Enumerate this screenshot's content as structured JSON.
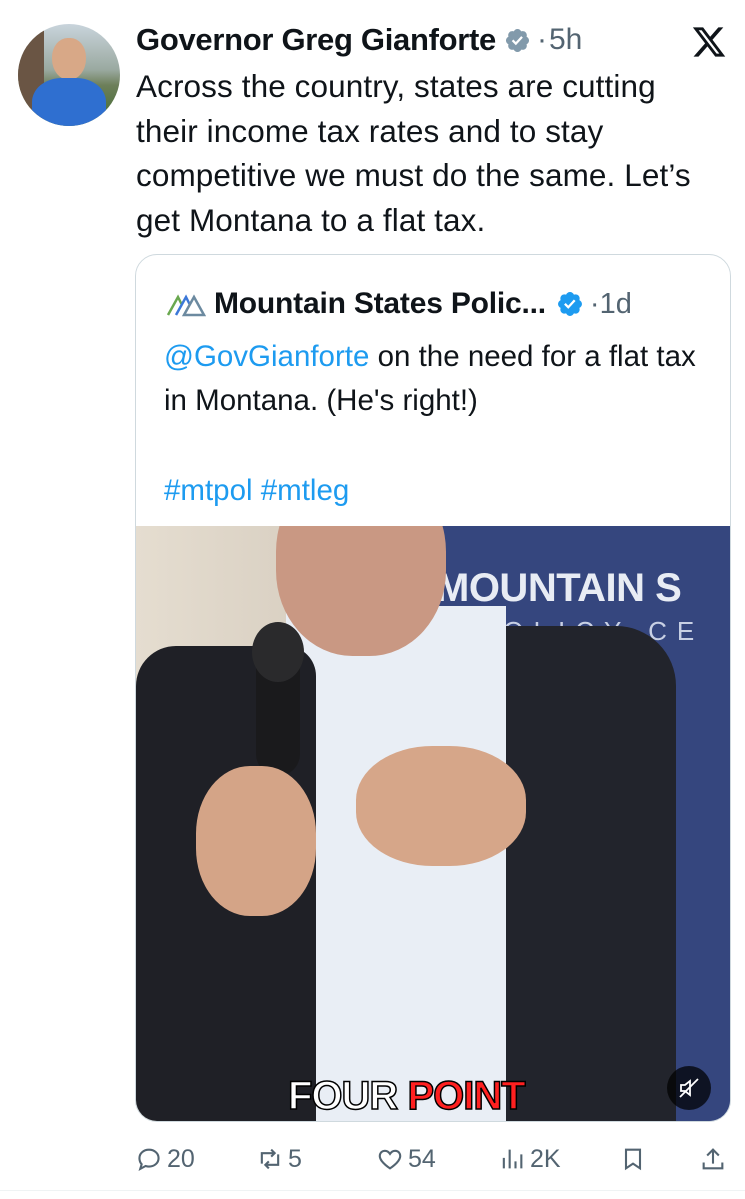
{
  "tweet": {
    "author_name": "Governor Greg Gianforte",
    "dot": "·",
    "time": "5h",
    "text": "Across the country, states are cutting their income tax rates and to stay competitive we must do the same. Let’s get Montana to a flat tax."
  },
  "quote": {
    "author_name": "Mountain States Polic...",
    "dot": "·",
    "time": "1d",
    "mention": "@GovGianforte",
    "text_rest": " on the need for a flat tax in Montana. (He's right!)",
    "hashtags": [
      "#mtpol",
      "#mtleg"
    ],
    "video": {
      "banner_line1": "MOUNTAIN S",
      "banner_line2": "POLICY CE",
      "caption_word1": "FOUR",
      "caption_word2": "POINT"
    }
  },
  "actions": {
    "replies": "20",
    "reposts": "5",
    "likes": "54",
    "views": "2K"
  },
  "icons": {
    "verified": "verified-badge-icon",
    "x_logo": "x-logo-icon",
    "reply": "reply-icon",
    "repost": "repost-icon",
    "like": "heart-icon",
    "views": "views-icon",
    "bookmark": "bookmark-icon",
    "share": "share-icon",
    "mute": "muted-speaker-icon"
  },
  "colors": {
    "link": "#1d9bf0",
    "text": "#0f1419",
    "secondary": "#536471",
    "verified": "#1d9bf0"
  }
}
